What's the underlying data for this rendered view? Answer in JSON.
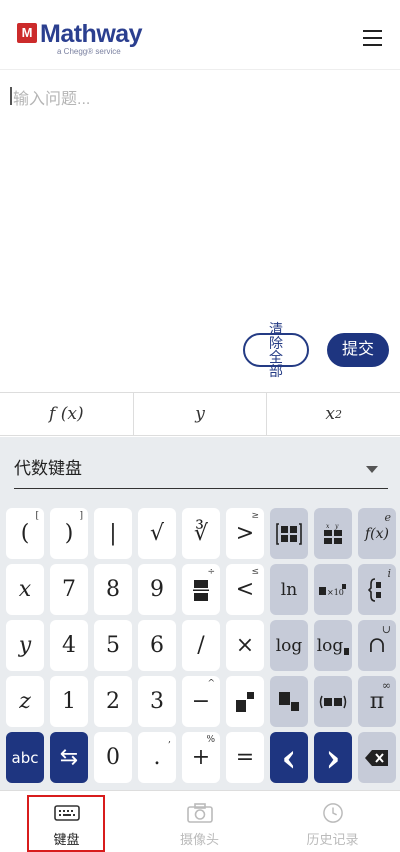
{
  "header": {
    "logo_mark": "M",
    "logo_text": "Mathway",
    "logo_sub": "a Chegg® service"
  },
  "input": {
    "placeholder": "输入问题..."
  },
  "actions": {
    "clear_label": "清除全部",
    "submit_label": "提交"
  },
  "function_tabs": [
    {
      "label": "f (x)"
    },
    {
      "label": "y"
    },
    {
      "label": "x",
      "sup": "2"
    }
  ],
  "keyboard": {
    "selected_keyboard": "代数键盘",
    "rows": [
      [
        {
          "main": "(",
          "alt": "["
        },
        {
          "main": ")",
          "alt": "]"
        },
        {
          "main": "|"
        },
        {
          "main": "√"
        },
        {
          "main": "∛"
        },
        {
          "main": ">",
          "alt": "≥"
        },
        {
          "main": "matrix",
          "gray": true
        },
        {
          "main": "det",
          "gray": true
        },
        {
          "main": "f(x)",
          "alt": "e",
          "gray": true
        }
      ],
      [
        {
          "main": "x",
          "italic": true
        },
        {
          "main": "7"
        },
        {
          "main": "8"
        },
        {
          "main": "9"
        },
        {
          "main": "fraction",
          "alt": "÷"
        },
        {
          "main": "<",
          "alt": "≤"
        },
        {
          "main": "ln",
          "gray": true
        },
        {
          "main": "sci",
          "gray": true
        },
        {
          "main": "cases",
          "alt": "i",
          "gray": true
        }
      ],
      [
        {
          "main": "y",
          "italic": true
        },
        {
          "main": "4"
        },
        {
          "main": "5"
        },
        {
          "main": "6"
        },
        {
          "main": "/"
        },
        {
          "main": "×"
        },
        {
          "main": "log",
          "gray": true
        },
        {
          "main": "log_b",
          "gray": true
        },
        {
          "main": "∩",
          "alt": "∪",
          "gray": true
        }
      ],
      [
        {
          "main": "z",
          "italic": true
        },
        {
          "main": "1"
        },
        {
          "main": "2"
        },
        {
          "main": "3"
        },
        {
          "main": "−",
          "alt": "^"
        },
        {
          "main": "power"
        },
        {
          "main": "subscript",
          "gray": true
        },
        {
          "main": "interval",
          "gray": true
        },
        {
          "main": "π",
          "alt": "∞",
          "gray": true
        }
      ],
      [
        {
          "main": "abc",
          "blue": true
        },
        {
          "main": "⇆",
          "blue": true
        },
        {
          "main": "0"
        },
        {
          "main": ".",
          "alt": ","
        },
        {
          "main": "+",
          "alt": "%"
        },
        {
          "main": "="
        },
        {
          "main": "‹",
          "blue": true
        },
        {
          "main": "›",
          "blue": true
        },
        {
          "main": "⌫",
          "gray": true
        }
      ]
    ]
  },
  "bottom_nav": [
    {
      "label": "键盘",
      "icon": "keyboard-icon",
      "active": true
    },
    {
      "label": "摄像头",
      "icon": "camera-icon",
      "active": false
    },
    {
      "label": "历史记录",
      "icon": "clock-icon",
      "active": false
    }
  ],
  "colors": {
    "brand_blue": "#1e3580",
    "logo_red": "#cc2b2b",
    "highlight_red": "#d81c1c",
    "keyboard_bg": "#e9ecef"
  }
}
